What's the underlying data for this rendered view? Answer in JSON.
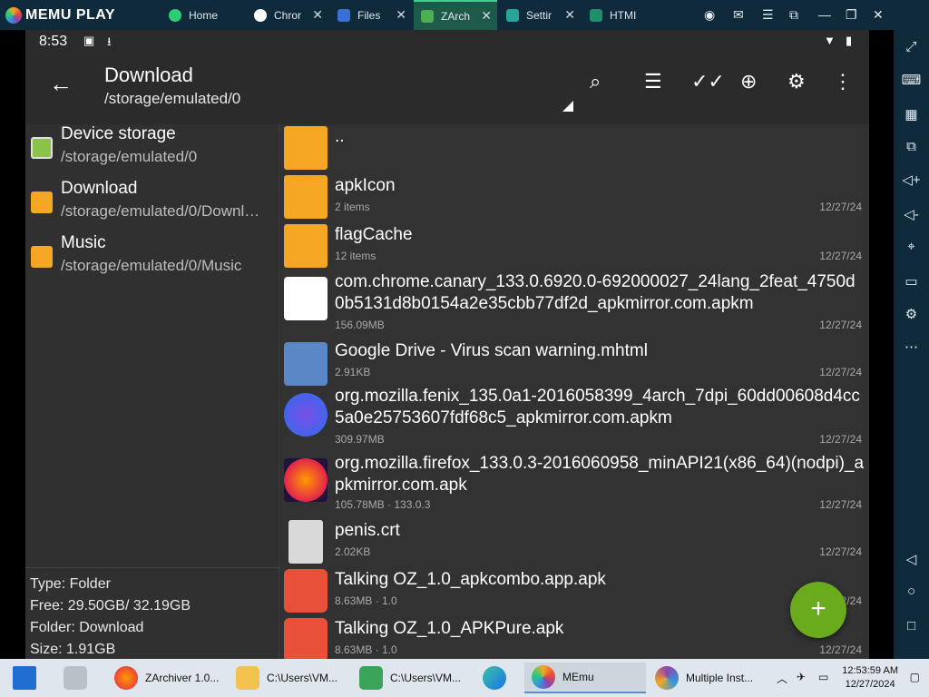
{
  "window": {
    "brand": "MEMU PLAY",
    "tabs": [
      {
        "label": "Home",
        "color": "#2ecc71"
      },
      {
        "label": "Chror",
        "color": "#ffffff"
      },
      {
        "label": "Files",
        "color": "#3b6fd8"
      },
      {
        "label": "ZArch",
        "color": "#4caf50"
      },
      {
        "label": "Settir",
        "color": "#26a69a"
      },
      {
        "label": "HTMI",
        "color": "#1f8f6a"
      }
    ]
  },
  "status": {
    "time": "8:53"
  },
  "appbar": {
    "title": "Download",
    "subtitle": "/storage/emulated/0"
  },
  "sidebar": {
    "items": [
      {
        "name": "Device storage",
        "path": "/storage/emulated/0",
        "icon": "device-storage-icon"
      },
      {
        "name": "Download",
        "path": "/storage/emulated/0/Downl…",
        "icon": "download-folder-icon"
      },
      {
        "name": "Music",
        "path": "/storage/emulated/0/Music",
        "icon": "music-folder-icon"
      }
    ],
    "info": {
      "type": "Type: Folder",
      "free": "Free: 29.50GB/ 32.19GB",
      "folder": "Folder: Download",
      "size": "Size: 1.91GB"
    }
  },
  "files": [
    {
      "name": "..",
      "meta": "",
      "date": "",
      "icon": "parent-folder-icon"
    },
    {
      "name": "apkIcon",
      "meta": "2 items",
      "date": "12/27/24",
      "icon": "folder-icon"
    },
    {
      "name": "flagCache",
      "meta": "12 items",
      "date": "12/27/24",
      "icon": "folder-icon"
    },
    {
      "name": "com.chrome.canary_133.0.6920.0-692000027_24lang_2feat_4750d0b5131d8b0154a2e35cbb77df2d_apkmirror.com.apkm",
      "meta": "156.09MB",
      "date": "12/27/24",
      "icon": "chrome-canary-icon"
    },
    {
      "name": "Google Drive - Virus scan warning.mhtml",
      "meta": "2.91KB",
      "date": "12/27/24",
      "icon": "web-file-icon"
    },
    {
      "name": "org.mozilla.fenix_135.0a1-2016058399_4arch_7dpi_60dd00608d4cc5a0e25753607fdf68c5_apkmirror.com.apkm",
      "meta": "309.97MB",
      "date": "12/27/24",
      "icon": "firefox-nightly-icon"
    },
    {
      "name": "org.mozilla.firefox_133.0.3-2016060958_minAPI21(x86_64)(nodpi)_apkmirror.com.apk",
      "meta": "105.78MB · 133.0.3",
      "date": "12/27/24",
      "icon": "firefox-icon"
    },
    {
      "name": "penis.crt",
      "meta": "2.02KB",
      "date": "12/27/24",
      "icon": "generic-file-icon"
    },
    {
      "name": "Talking OZ_1.0_apkcombo.app.apk",
      "meta": "8.63MB · 1.0",
      "date": "12/24",
      "icon": "talking-oz-icon"
    },
    {
      "name": "Talking OZ_1.0_APKPure.apk",
      "meta": "8.63MB · 1.0",
      "date": "12/27/24",
      "icon": "talking-oz-icon"
    }
  ],
  "taskbar": {
    "items": [
      {
        "label": "ZArchiver 1.0...",
        "icon": "firefox-icon"
      },
      {
        "label": "C:\\Users\\VM...",
        "icon": "file-explorer-icon"
      },
      {
        "label": "C:\\Users\\VM...",
        "icon": "download-icon"
      },
      {
        "label": "MEmu",
        "icon": "memu-icon"
      },
      {
        "label": "Multiple Inst...",
        "icon": "multi-instance-icon"
      }
    ],
    "clock_time": "12:53:59 AM",
    "clock_date": "12/27/2024"
  }
}
